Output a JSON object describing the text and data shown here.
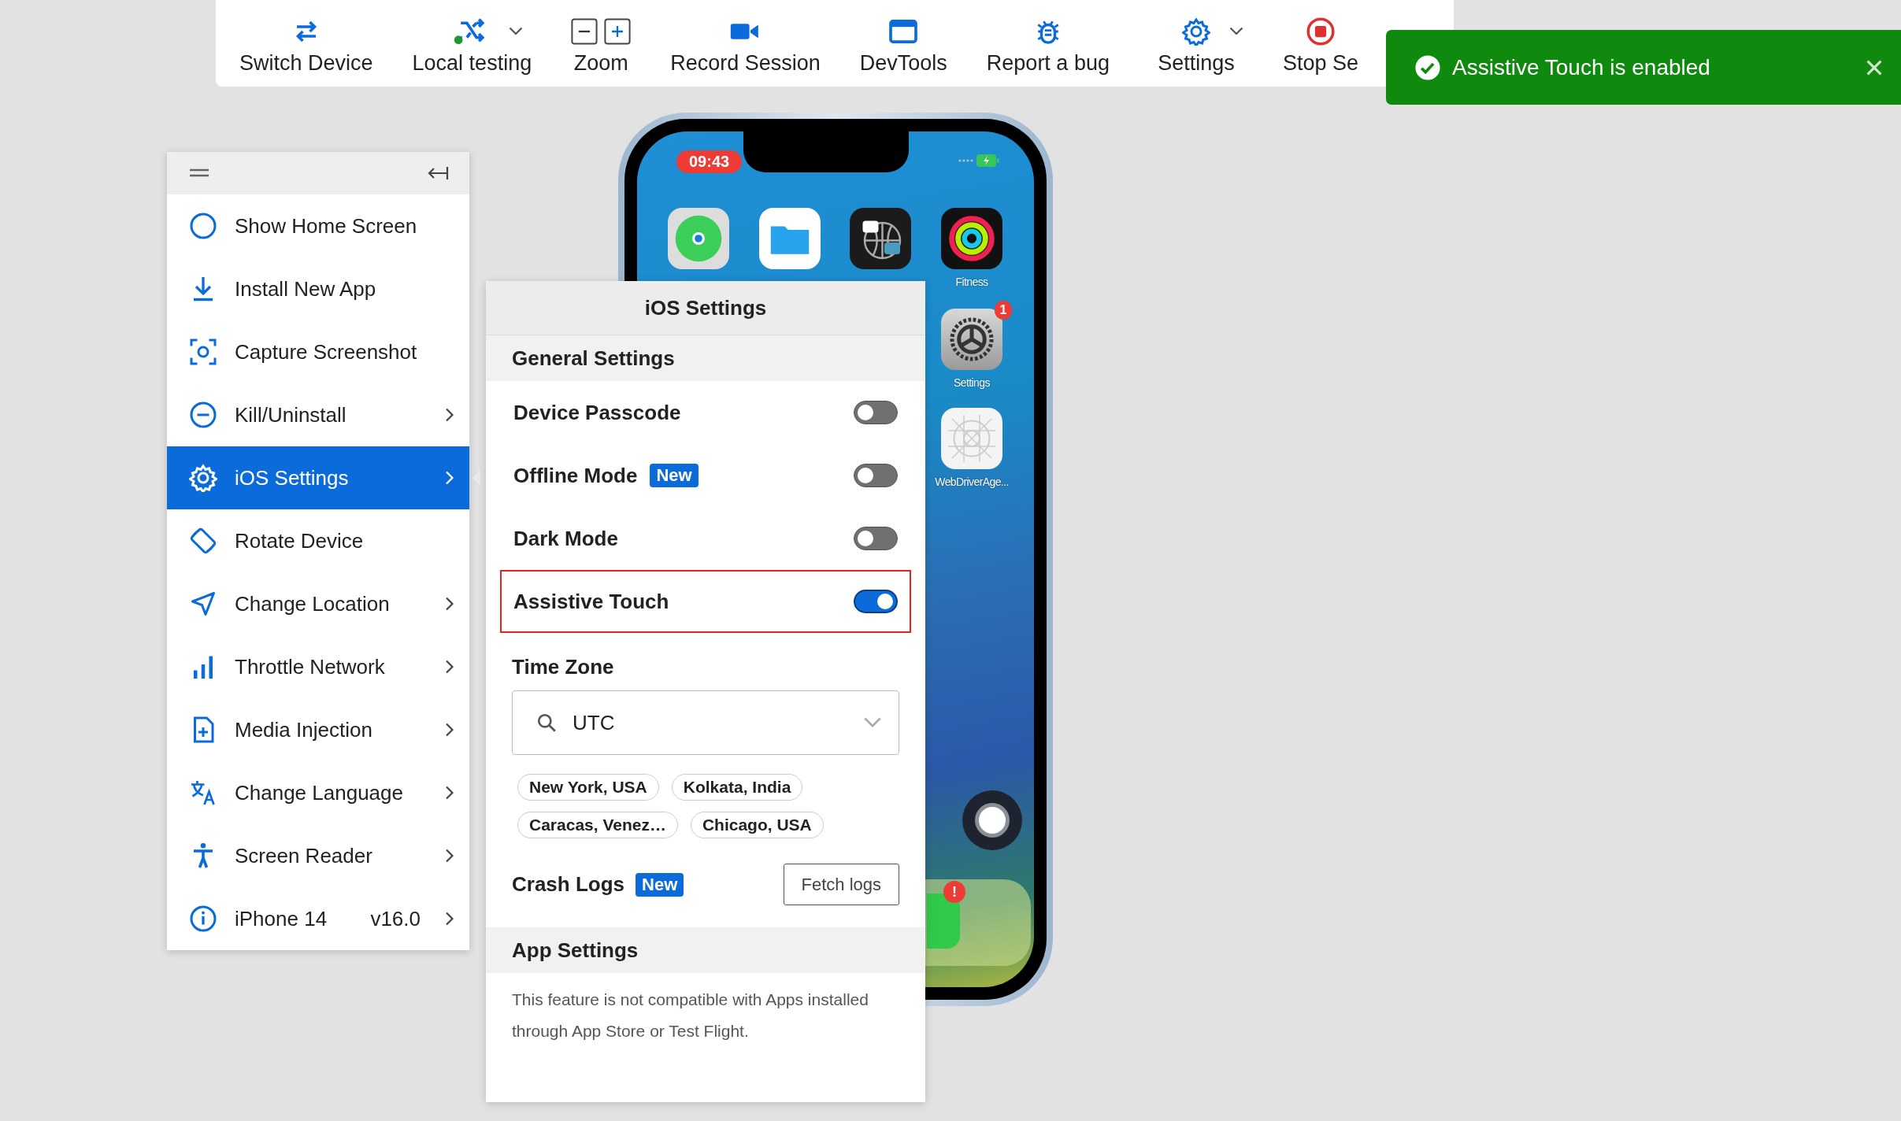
{
  "toolbar": [
    {
      "label": "Switch Device",
      "has_menu": false
    },
    {
      "label": "Local testing",
      "has_menu": true
    },
    {
      "label": "Zoom",
      "has_menu": false
    },
    {
      "label": "Record Session",
      "has_menu": false
    },
    {
      "label": "DevTools",
      "has_menu": false
    },
    {
      "label": "Report a bug",
      "has_menu": false
    },
    {
      "label": "Settings",
      "has_menu": true
    },
    {
      "label": "Stop Se",
      "has_menu": false
    }
  ],
  "toast": {
    "message": "Assistive Touch is enabled"
  },
  "side_menu": {
    "items": [
      {
        "label": "Show Home Screen",
        "submenu": false,
        "selected": false
      },
      {
        "label": "Install New App",
        "submenu": false,
        "selected": false
      },
      {
        "label": "Capture Screenshot",
        "submenu": false,
        "selected": false
      },
      {
        "label": "Kill/Uninstall",
        "submenu": true,
        "selected": false
      },
      {
        "label": "iOS Settings",
        "submenu": true,
        "selected": true
      },
      {
        "label": "Rotate Device",
        "submenu": false,
        "selected": false
      },
      {
        "label": "Change Location",
        "submenu": true,
        "selected": false
      },
      {
        "label": "Throttle Network",
        "submenu": true,
        "selected": false
      },
      {
        "label": "Media Injection",
        "submenu": true,
        "selected": false
      },
      {
        "label": "Change Language",
        "submenu": true,
        "selected": false
      },
      {
        "label": "Screen Reader",
        "submenu": true,
        "selected": false
      },
      {
        "label": "iPhone 14",
        "detail": "v16.0",
        "submenu": true,
        "selected": false
      }
    ]
  },
  "ios_settings": {
    "title": "iOS Settings",
    "general": {
      "heading": "General Settings",
      "toggles": [
        {
          "label": "Device Passcode",
          "on": false,
          "highlighted": false
        },
        {
          "label": "Offline Mode",
          "badge": "New",
          "on": false,
          "highlighted": false
        },
        {
          "label": "Dark Mode",
          "on": false,
          "highlighted": false
        },
        {
          "label": "Assistive Touch",
          "on": true,
          "highlighted": true
        }
      ]
    },
    "time_zone": {
      "label": "Time Zone",
      "value": "UTC",
      "suggestions": [
        "New York, USA",
        "Kolkata, India",
        "Caracas, Venez…",
        "Chicago, USA"
      ]
    },
    "crash_logs": {
      "label": "Crash Logs",
      "badge": "New",
      "button": "Fetch logs"
    },
    "app_settings": {
      "heading": "App Settings",
      "note": "This feature is not compatible with Apps installed through App Store or Test Flight."
    }
  },
  "phone": {
    "time": "09:43",
    "apps": [
      {
        "label": "Fitness"
      },
      {
        "label": "Settings",
        "badge": "1"
      },
      {
        "label": "WebDriverAge..."
      }
    ],
    "dock_badge": "!"
  }
}
